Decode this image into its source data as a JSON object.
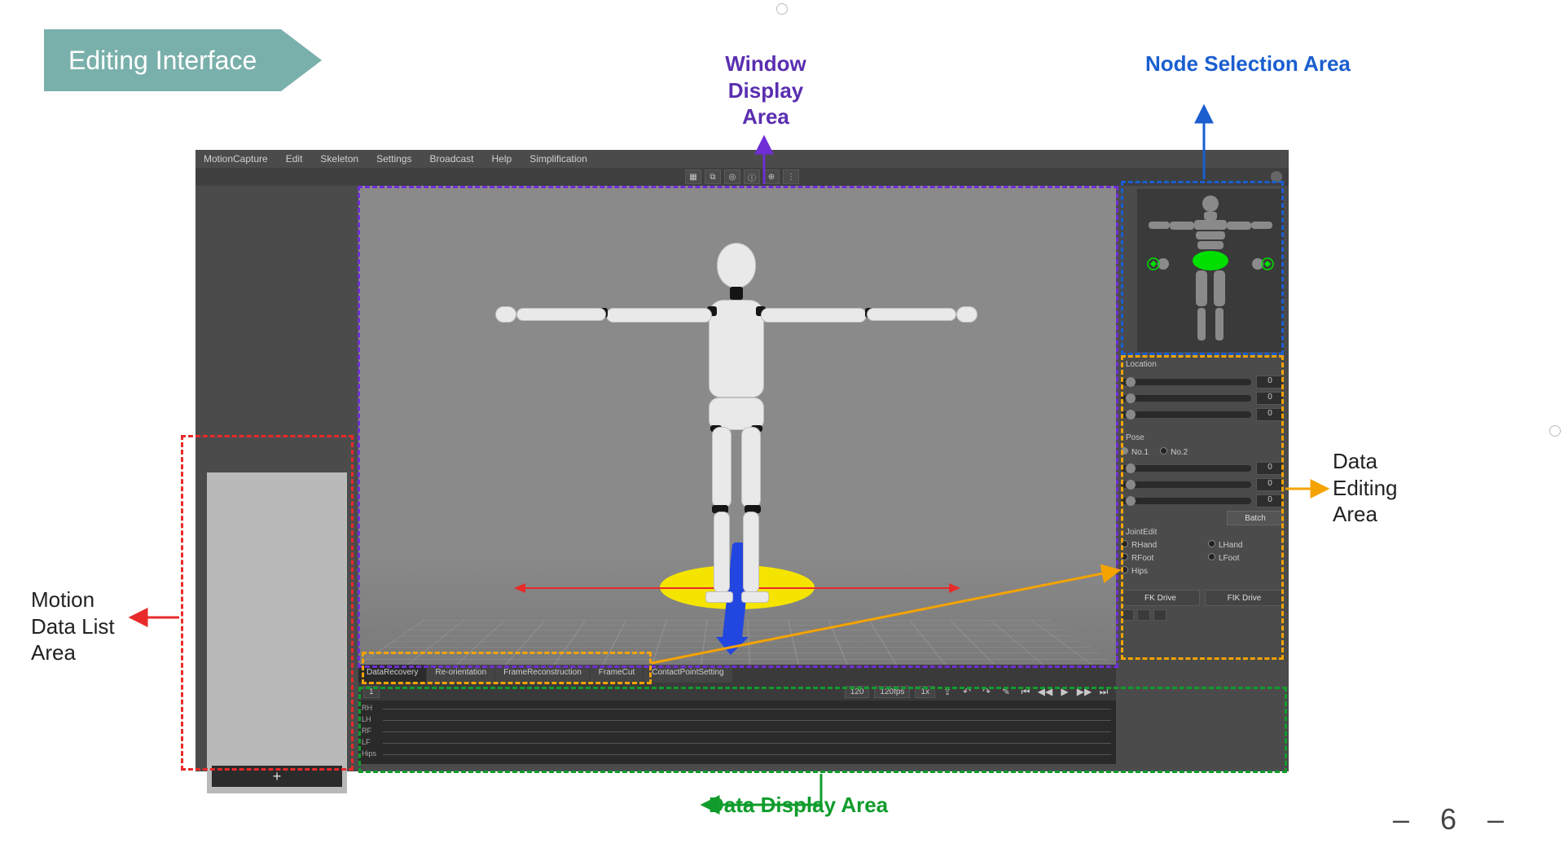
{
  "slide": {
    "title": "Editing Interface",
    "page_number": "6"
  },
  "callouts": {
    "window_display": "Window\nDisplay\nArea",
    "node_selection": "Node Selection Area",
    "data_editing": "Data\nEditing\nArea",
    "motion_list": "Motion\nData List\nArea",
    "data_display": "Data Display Area"
  },
  "menu": {
    "items": [
      "MotionCapture",
      "Edit",
      "Skeleton",
      "Settings",
      "Broadcast",
      "Help",
      "Simplification"
    ]
  },
  "top_toolbar": {
    "icons": [
      "grid-icon",
      "layers-icon",
      "target-icon",
      "info-icon",
      "globe-icon",
      "options-icon"
    ]
  },
  "tool_tabs": {
    "items": [
      "DataRecovery",
      "Re-orientation",
      "FrameReconstruction",
      "FrameCut",
      "ContactPointSetting"
    ]
  },
  "timeline": {
    "tracks": [
      "RH",
      "LH",
      "RF",
      "LF",
      "Hips"
    ],
    "frame_start": "1",
    "frame_end": "120",
    "fps": "120fps",
    "speed": "1x",
    "controls": [
      "export-icon",
      "undo-icon",
      "redo-icon",
      "tool-icon",
      "skip-back-icon",
      "step-back-icon",
      "play-icon",
      "step-fwd-icon",
      "skip-fwd-icon"
    ]
  },
  "left_panel": {
    "add_label": "+"
  },
  "right": {
    "location_header": "Location",
    "location_values": [
      "0",
      "0",
      "0"
    ],
    "pose_header": "Pose",
    "pose_options": [
      "No.1",
      "No.2"
    ],
    "pose_sliders": [
      "0",
      "0",
      "0"
    ],
    "batch_button": "Batch",
    "joint_edit_header": "JointEdit",
    "joint_options": [
      "RHand",
      "LHand",
      "RFoot",
      "LFoot",
      "Hips"
    ],
    "drive_buttons": [
      "FK Drive",
      "FIK Drive"
    ]
  },
  "colors": {
    "purple": "#6f2ed6",
    "blue": "#1a5ed0",
    "orange": "#f5a300",
    "red": "#e82a2a",
    "green": "#109c2c"
  }
}
